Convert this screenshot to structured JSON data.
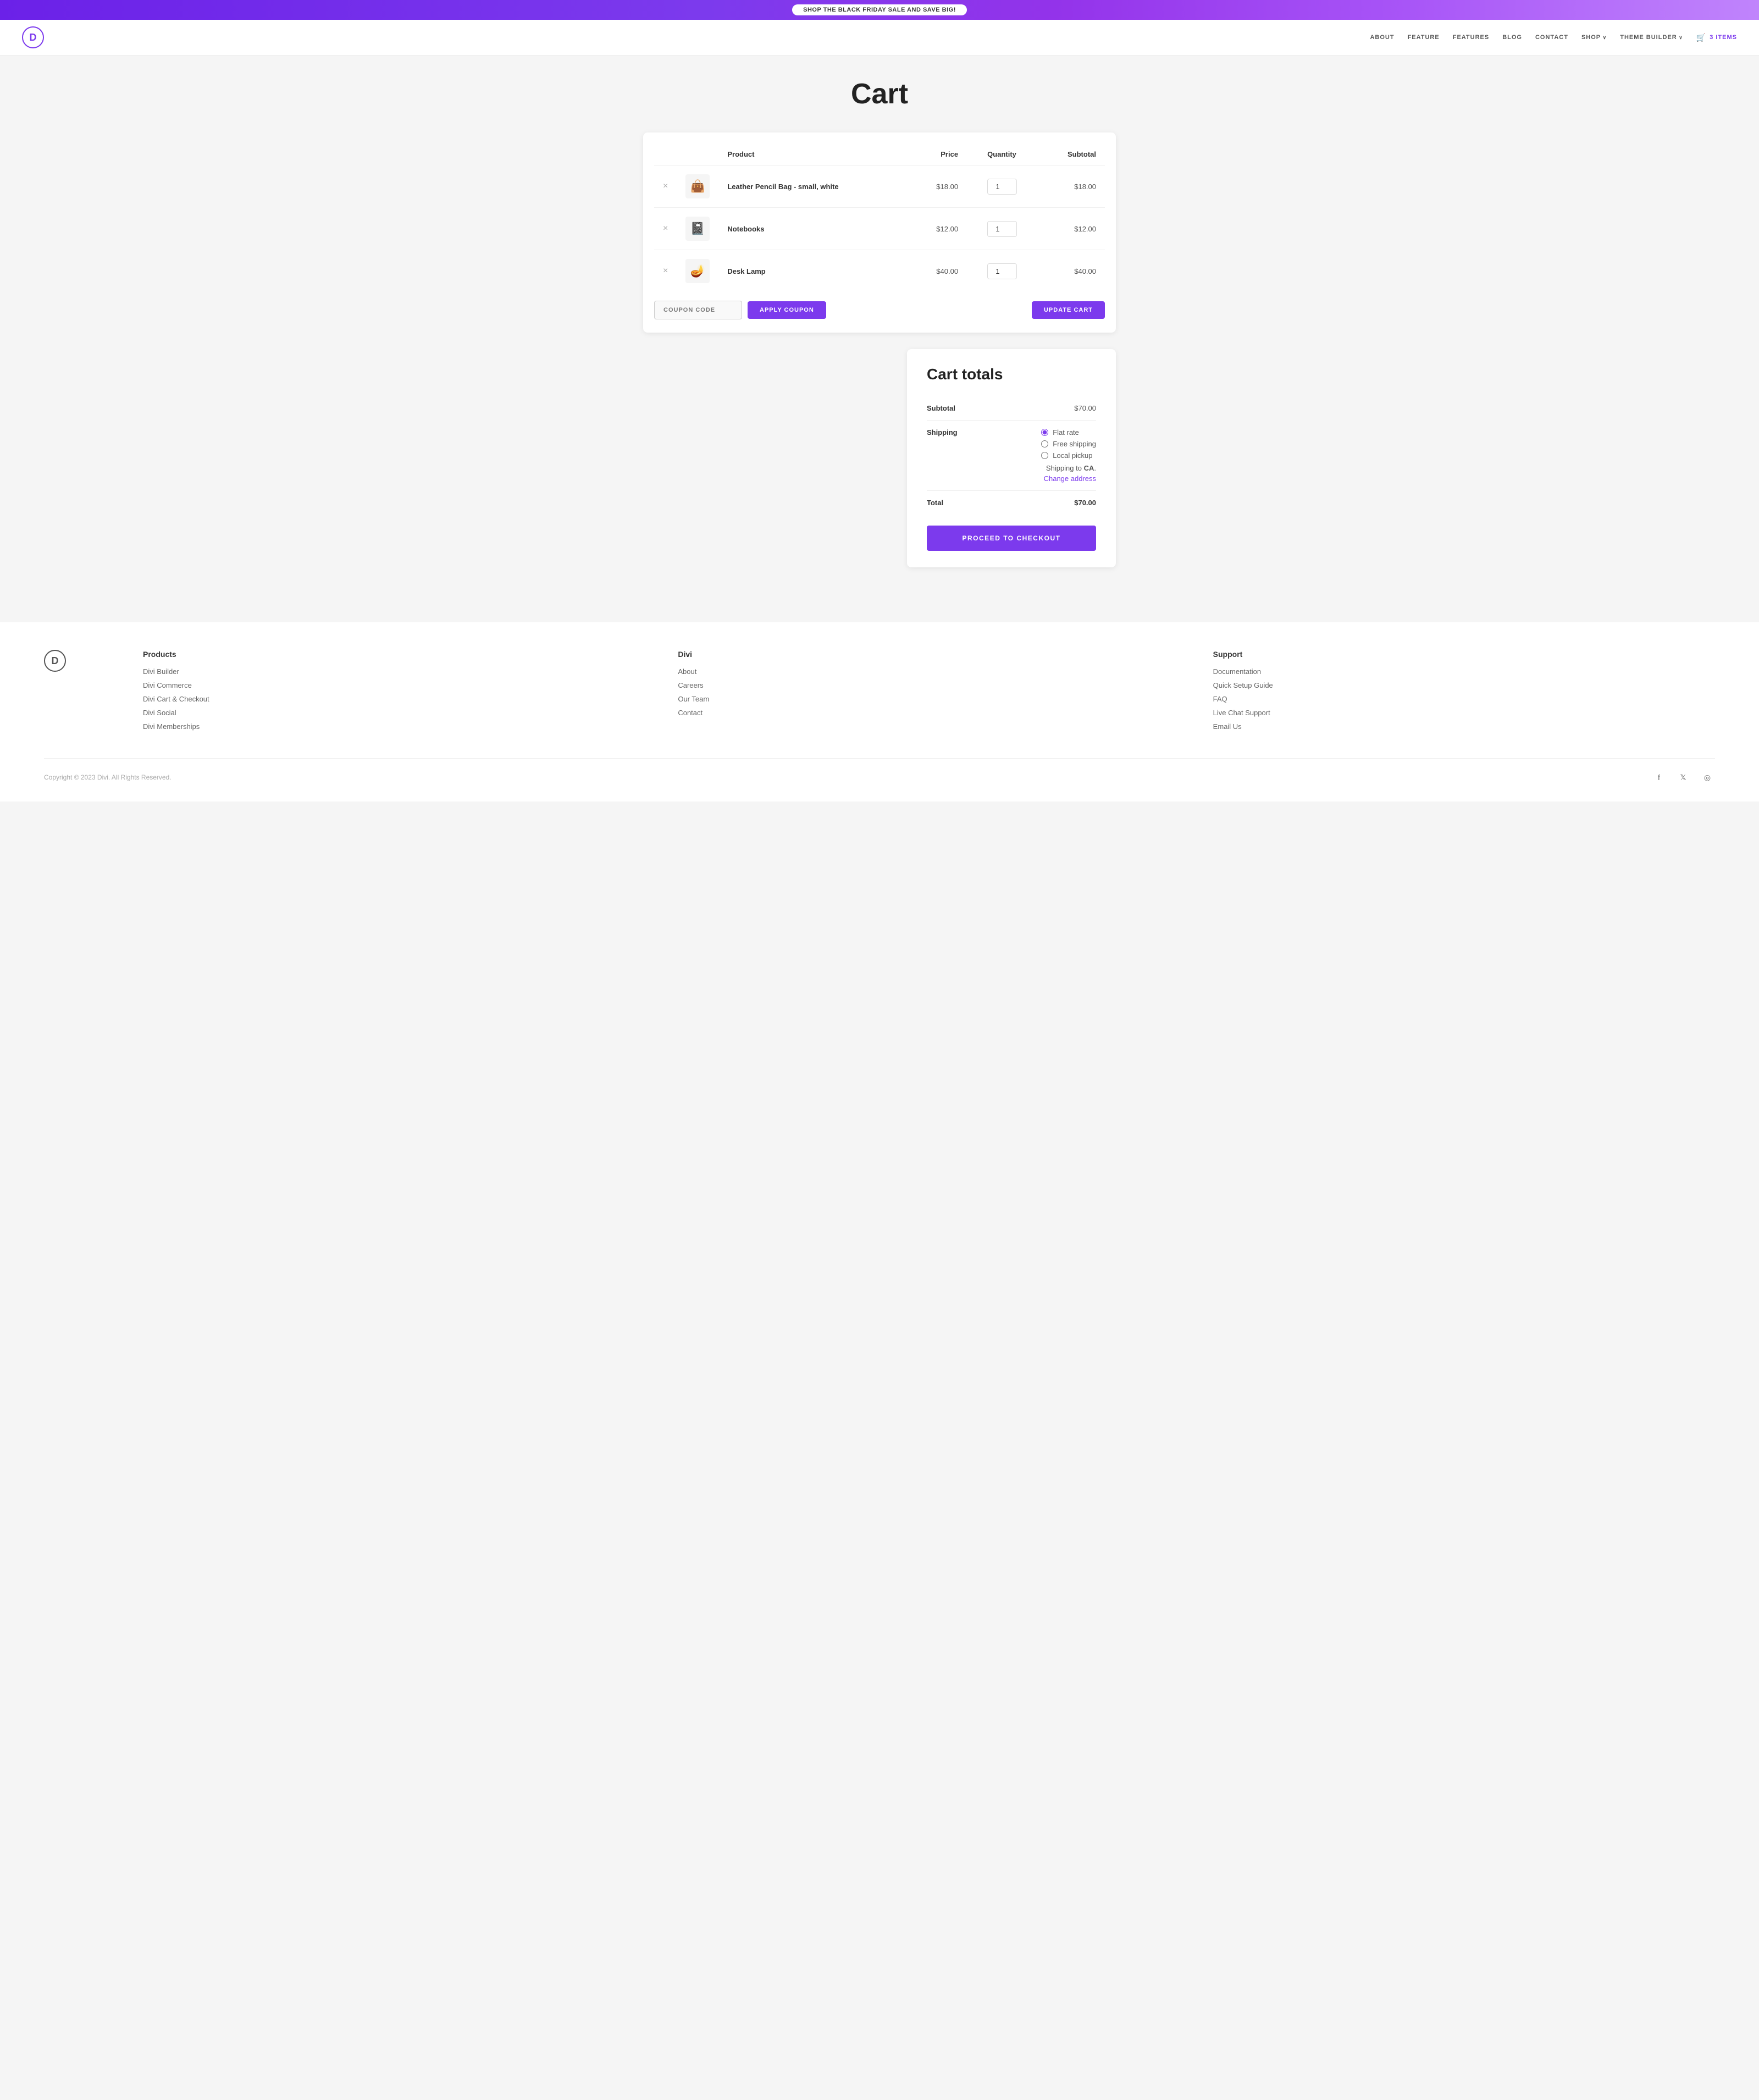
{
  "banner": {
    "text": "SHOP THE BLACK FRIDAY SALE AND SAVE BIG!"
  },
  "header": {
    "logo_letter": "D",
    "nav_items": [
      {
        "label": "ABOUT",
        "has_arrow": false
      },
      {
        "label": "FEATURE",
        "has_arrow": false
      },
      {
        "label": "FEATURES",
        "has_arrow": false
      },
      {
        "label": "BLOG",
        "has_arrow": false
      },
      {
        "label": "CONTACT",
        "has_arrow": false
      },
      {
        "label": "SHOP",
        "has_arrow": true
      },
      {
        "label": "THEME BUILDER",
        "has_arrow": true
      }
    ],
    "cart_label": "3 ITEMS"
  },
  "page": {
    "title": "Cart"
  },
  "cart": {
    "columns": {
      "product": "Product",
      "price": "Price",
      "quantity": "Quantity",
      "subtotal": "Subtotal"
    },
    "items": [
      {
        "name": "Leather Pencil Bag - small, white",
        "price": "$18.00",
        "quantity": 1,
        "subtotal": "$18.00",
        "icon": "👜"
      },
      {
        "name": "Notebooks",
        "price": "$12.00",
        "quantity": 1,
        "subtotal": "$12.00",
        "icon": "📓"
      },
      {
        "name": "Desk Lamp",
        "price": "$40.00",
        "quantity": 1,
        "subtotal": "$40.00",
        "icon": "🪔"
      }
    ],
    "coupon_placeholder": "COUPON CODE",
    "apply_coupon_label": "APPLY COUPON",
    "update_cart_label": "UPDATE CART"
  },
  "cart_totals": {
    "title": "Cart totals",
    "subtotal_label": "Subtotal",
    "subtotal_value": "$70.00",
    "shipping_label": "Shipping",
    "shipping_options": [
      {
        "label": "Flat rate",
        "checked": true
      },
      {
        "label": "Free shipping",
        "checked": false
      },
      {
        "label": "Local pickup",
        "checked": false
      }
    ],
    "shipping_to_text": "Shipping to CA.",
    "change_address_label": "Change address",
    "total_label": "Total",
    "total_value": "$70.00",
    "checkout_label": "PROCEED TO CHECKOUT"
  },
  "footer": {
    "logo_letter": "D",
    "columns": [
      {
        "title": "Products",
        "links": [
          "Divi Builder",
          "Divi Commerce",
          "Divi Cart & Checkout",
          "Divi Social",
          "Divi Memberships"
        ]
      },
      {
        "title": "Divi",
        "links": [
          "About",
          "Careers",
          "Our Team",
          "Contact"
        ]
      },
      {
        "title": "Support",
        "links": [
          "Documentation",
          "Quick Setup Guide",
          "FAQ",
          "Live Chat Support",
          "Email Us"
        ]
      }
    ],
    "copyright": "Copyright © 2023 Divi. All Rights Reserved.",
    "social": [
      "f",
      "𝕏",
      "⊙"
    ]
  }
}
